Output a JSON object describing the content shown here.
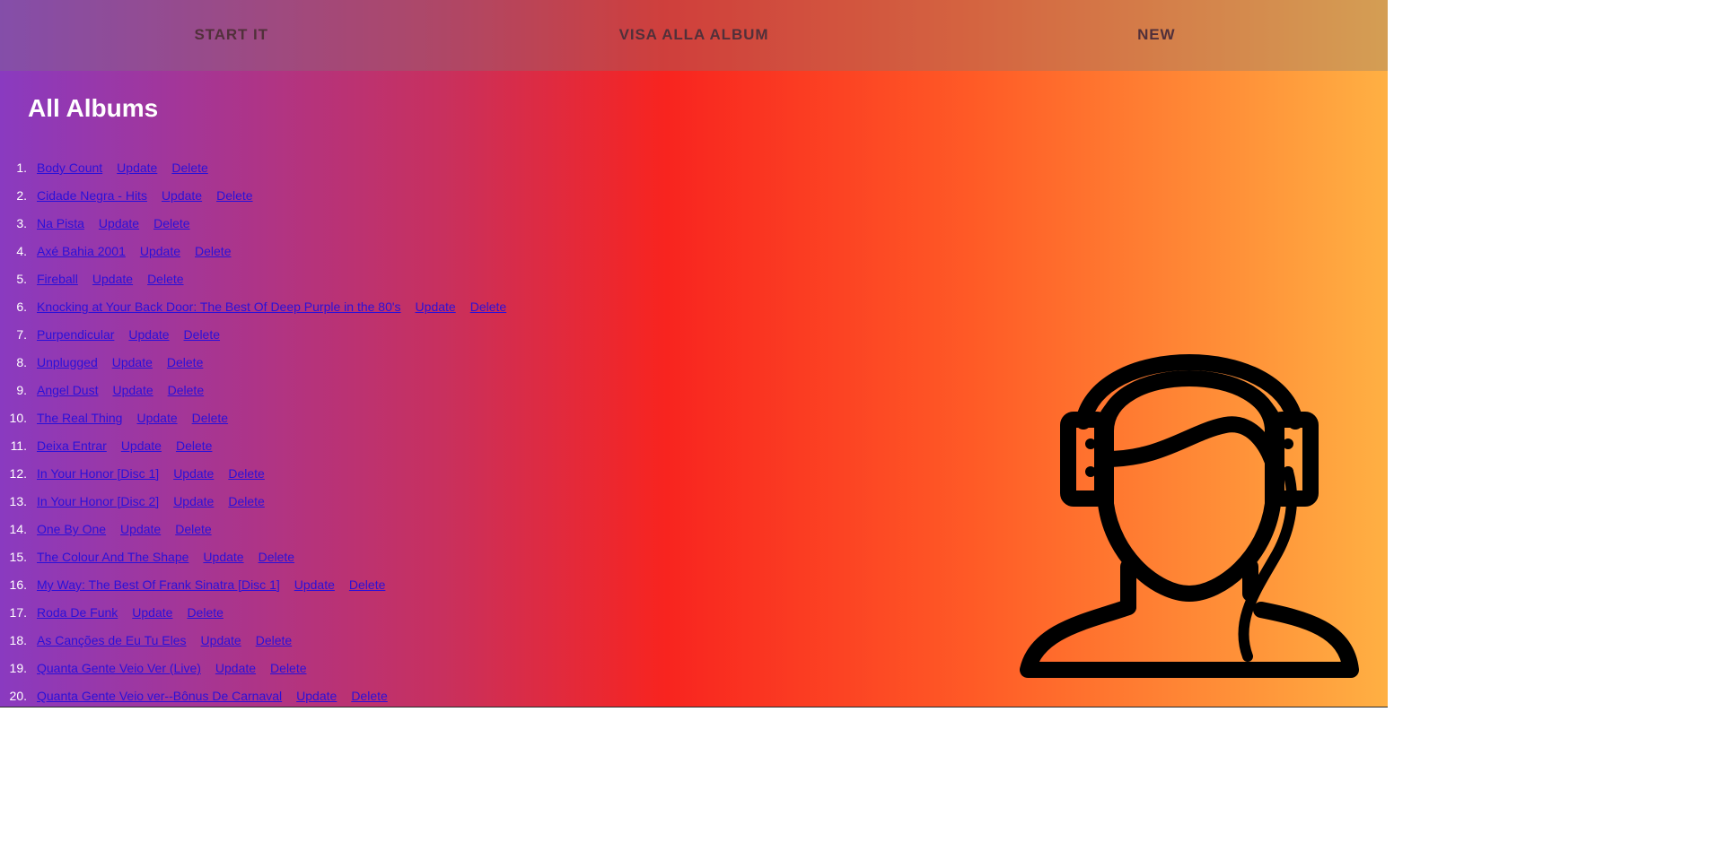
{
  "nav": {
    "items": [
      {
        "label": "START IT"
      },
      {
        "label": "VISA ALLA ALBUM"
      },
      {
        "label": "NEW"
      }
    ]
  },
  "page": {
    "title": "All Albums"
  },
  "albums": {
    "update_label": "Update",
    "delete_label": "Delete",
    "items": [
      {
        "num": "1.",
        "title": "Body Count"
      },
      {
        "num": "2.",
        "title": "Cidade Negra - Hits"
      },
      {
        "num": "3.",
        "title": "Na Pista"
      },
      {
        "num": "4.",
        "title": "Axé Bahia 2001"
      },
      {
        "num": "5.",
        "title": "Fireball"
      },
      {
        "num": "6.",
        "title": "Knocking at Your Back Door: The Best Of Deep Purple in the 80's"
      },
      {
        "num": "7.",
        "title": "Purpendicular"
      },
      {
        "num": "8.",
        "title": "Unplugged"
      },
      {
        "num": "9.",
        "title": "Angel Dust"
      },
      {
        "num": "10.",
        "title": "The Real Thing"
      },
      {
        "num": "11.",
        "title": "Deixa Entrar"
      },
      {
        "num": "12.",
        "title": "In Your Honor [Disc 1]"
      },
      {
        "num": "13.",
        "title": "In Your Honor [Disc 2]"
      },
      {
        "num": "14.",
        "title": "One By One"
      },
      {
        "num": "15.",
        "title": "The Colour And The Shape"
      },
      {
        "num": "16.",
        "title": "My Way: The Best Of Frank Sinatra [Disc 1]"
      },
      {
        "num": "17.",
        "title": "Roda De Funk"
      },
      {
        "num": "18.",
        "title": "As Canções de Eu Tu Eles"
      },
      {
        "num": "19.",
        "title": "Quanta Gente Veio Ver (Live)"
      },
      {
        "num": "20.",
        "title": "Quanta Gente Veio ver--Bônus De Carnaval"
      }
    ]
  },
  "icons": {
    "hero": "headphones-person-icon"
  },
  "colors": {
    "gradient_start": "#8a3ac0",
    "gradient_mid": "#f8241f",
    "gradient_end": "#ffb043",
    "link": "#2b10d8",
    "nav_text": "#51303a",
    "title_text": "#ffffff"
  }
}
